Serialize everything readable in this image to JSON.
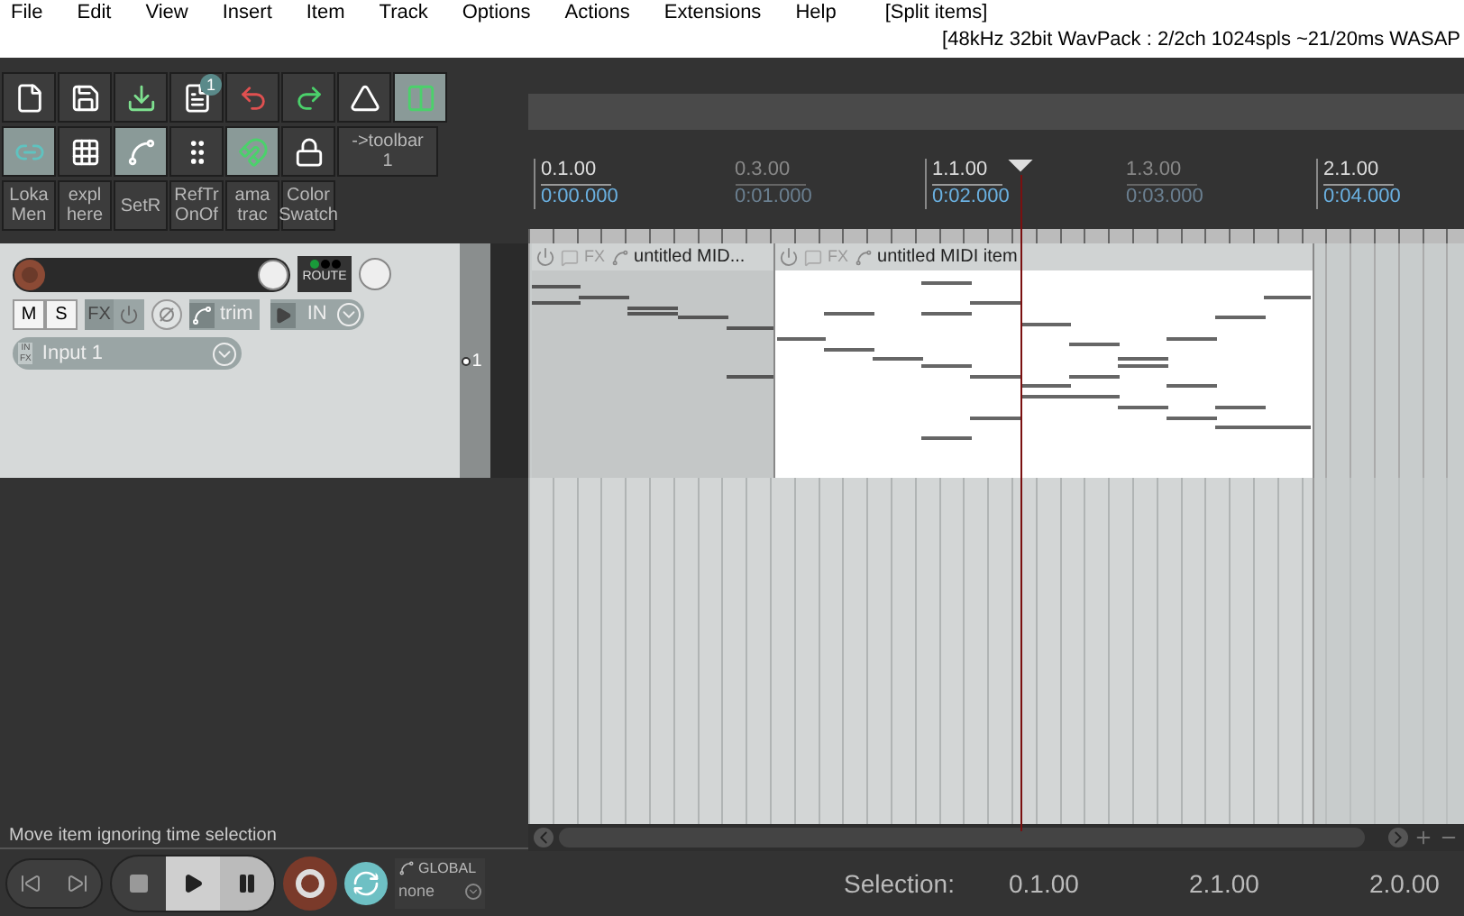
{
  "menu": [
    "File",
    "Edit",
    "View",
    "Insert",
    "Item",
    "Track",
    "Options",
    "Actions",
    "Extensions",
    "Help"
  ],
  "menu_action": "[Split items]",
  "status_info": "[48kHz 32bit WavPack : 2/2ch 1024spls ~21/20ms WASAP",
  "toolbar": {
    "rows": [
      [
        {
          "kind": "icon",
          "on": false
        },
        {
          "kind": "icon",
          "on": false
        },
        {
          "kind": "icon",
          "on": false
        },
        {
          "kind": "icon",
          "on": false,
          "badge": "1"
        },
        {
          "kind": "icon",
          "on": false
        },
        {
          "kind": "icon",
          "on": false
        },
        {
          "kind": "icon",
          "on": false
        },
        {
          "kind": "icon",
          "on": true
        }
      ],
      [
        {
          "kind": "icon",
          "on": true
        },
        {
          "kind": "icon",
          "on": false
        },
        {
          "kind": "icon",
          "on": true
        },
        {
          "kind": "icon",
          "on": false
        },
        {
          "kind": "icon",
          "on": true
        },
        {
          "kind": "icon",
          "on": false
        },
        {
          "kind": "text",
          "lines": [
            "->toolbar",
            "1"
          ]
        }
      ],
      [
        {
          "kind": "text",
          "lines": [
            "Loka",
            "Men"
          ]
        },
        {
          "kind": "text",
          "lines": [
            "expl",
            "here"
          ]
        },
        {
          "kind": "text",
          "lines": [
            "SetR"
          ]
        },
        {
          "kind": "text",
          "lines": [
            "RefTr",
            "OnOf"
          ]
        },
        {
          "kind": "text",
          "lines": [
            "ama",
            "trac"
          ]
        },
        {
          "kind": "text",
          "lines": [
            "Color",
            "Swatch"
          ]
        }
      ]
    ]
  },
  "ruler": [
    {
      "kind": "major",
      "bar": "0.1.00",
      "time": "0:00.000"
    },
    {
      "kind": "minor",
      "bar": "0.3.00",
      "time": "0:01.000"
    },
    {
      "kind": "major",
      "bar": "1.1.00",
      "time": "0:02.000"
    },
    {
      "kind": "minor",
      "bar": "1.3.00",
      "time": "0:03.000"
    },
    {
      "kind": "major",
      "bar": "2.1.00",
      "time": "0:04.000"
    }
  ],
  "track": {
    "number": "1",
    "route": "ROUTE",
    "mute": "M",
    "solo": "S",
    "fx": "FX",
    "trim": "trim",
    "input_mode": "IN",
    "input": "Input 1",
    "in_fx": [
      "IN",
      "FX"
    ]
  },
  "items": [
    {
      "name": "untitled MID...",
      "fx": "FX",
      "selected": false
    },
    {
      "name": "untitled MIDI item",
      "fx": "FX",
      "selected": true
    }
  ],
  "hint": "Move item ignoring time selection",
  "transport": {
    "automation": "GLOBAL",
    "automation_mode": "none"
  },
  "selection": {
    "label": "Selection:",
    "start": "0.1.00",
    "end": "2.1.00",
    "length": "2.0.00"
  }
}
